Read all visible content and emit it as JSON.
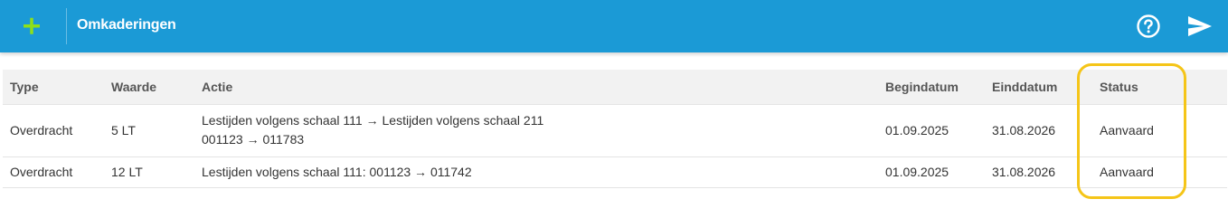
{
  "header": {
    "title": "Omkaderingen",
    "add_icon": "plus-icon",
    "help_icon": "help-circle-icon",
    "send_icon": "send-icon"
  },
  "colors": {
    "header_bg": "#1b9ad6",
    "add_icon": "#8de01a",
    "highlight": "#f5c518"
  },
  "table": {
    "columns": [
      "Type",
      "Waarde",
      "Actie",
      "Begindatum",
      "Einddatum",
      "Status"
    ],
    "rows": [
      {
        "type": "Overdracht",
        "waarde": "5 LT",
        "actie_line1": "Lestijden volgens schaal 111 → Lestijden volgens schaal 211",
        "actie_line2": "001123 → 011783",
        "begindatum": "01.09.2025",
        "einddatum": "31.08.2026",
        "status": "Aanvaard"
      },
      {
        "type": "Overdracht",
        "waarde": "12 LT",
        "actie_line1": "Lestijden volgens schaal 111: 001123 → 011742",
        "begindatum": "01.09.2025",
        "einddatum": "31.08.2026",
        "status": "Aanvaard"
      }
    ]
  }
}
